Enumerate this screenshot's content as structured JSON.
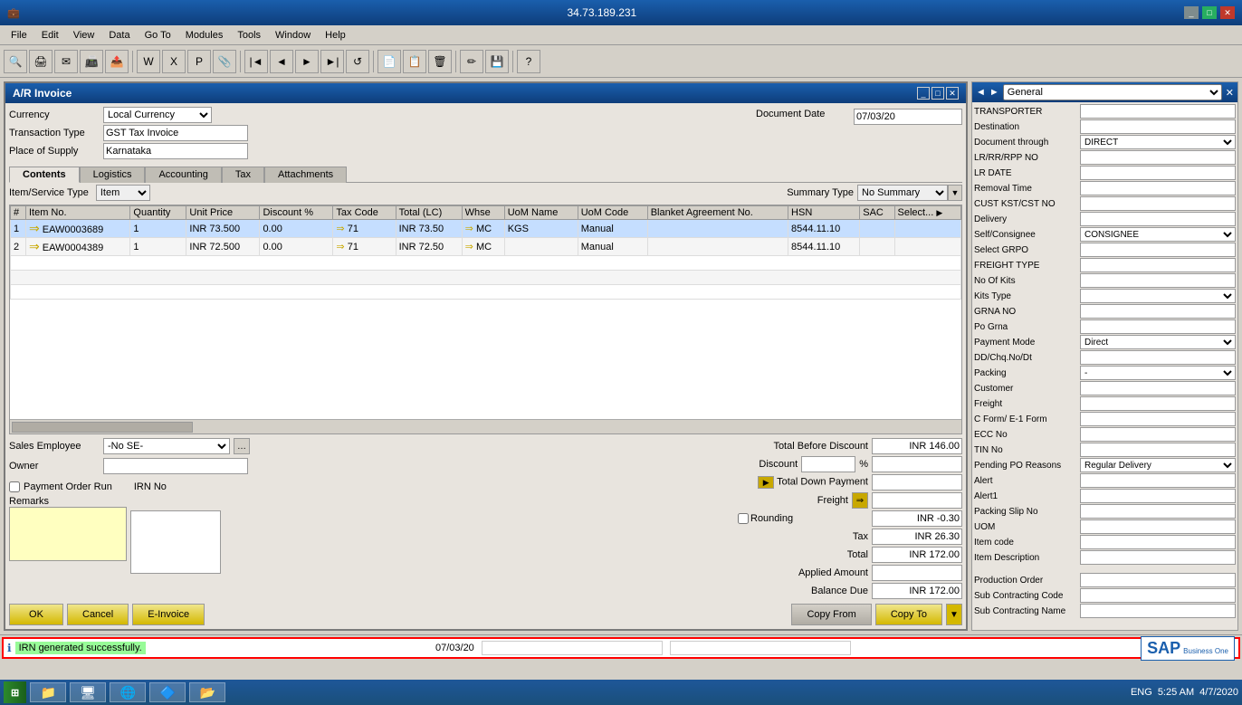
{
  "titlebar": {
    "title": "34.73.189.231",
    "controls": [
      "_",
      "□",
      "✕"
    ]
  },
  "menubar": {
    "items": [
      "File",
      "Edit",
      "View",
      "Data",
      "Go To",
      "Modules",
      "Tools",
      "Window",
      "Help"
    ]
  },
  "invoice": {
    "title": "A/R Invoice",
    "currency_label": "Currency",
    "currency_value": "Local Currency",
    "doc_date_label": "Document Date",
    "doc_date_value": "07/03/20",
    "transaction_type_label": "Transaction Type",
    "transaction_type_value": "GST Tax Invoice",
    "place_of_supply_label": "Place of Supply",
    "place_of_supply_value": "Karnataka",
    "tabs": [
      "Contents",
      "Logistics",
      "Accounting",
      "Tax",
      "Attachments"
    ],
    "active_tab": "Contents",
    "table": {
      "headers": [
        "#",
        "Item No.",
        "Quantity",
        "Unit Price",
        "Discount %",
        "Tax Code",
        "Total (LC)",
        "Whse",
        "UoM Name",
        "UoM Code",
        "Blanket Agreement No.",
        "HSN",
        "SAC",
        "Select..."
      ],
      "rows": [
        {
          "num": "1",
          "item_no": "EAW0003689",
          "quantity": "1",
          "unit_price": "INR 73.500",
          "discount": "0.00",
          "tax_code": "71",
          "total_lc": "INR 73.50",
          "whse": "MC",
          "uom_name": "KGS",
          "uom_code": "Manual",
          "blanket_agr": "",
          "hsn": "8544.11.10",
          "sac": "",
          "select": ""
        },
        {
          "num": "2",
          "item_no": "EAW0004389",
          "quantity": "1",
          "unit_price": "INR 72.500",
          "discount": "0.00",
          "tax_code": "71",
          "total_lc": "INR 72.50",
          "whse": "MC",
          "uom_name": "",
          "uom_code": "Manual",
          "blanket_agr": "",
          "hsn": "8544.11.10",
          "sac": "",
          "select": ""
        }
      ]
    },
    "sales_employee_label": "Sales Employee",
    "sales_employee_value": "-No SE-",
    "owner_label": "Owner",
    "owner_value": "",
    "summary_type_label": "Summary Type",
    "summary_type_value": "No Summary",
    "totals": {
      "before_discount_label": "Total Before Discount",
      "before_discount_value": "INR 146.00",
      "discount_label": "Discount",
      "discount_pct": "%",
      "down_payment_label": "Total Down Payment",
      "freight_label": "Freight",
      "rounding_label": "Rounding",
      "rounding_value": "INR -0.30",
      "tax_label": "Tax",
      "tax_value": "INR 26.30",
      "total_label": "Total",
      "total_value": "INR 172.00",
      "applied_amount_label": "Applied Amount",
      "applied_amount_value": "",
      "balance_due_label": "Balance Due",
      "balance_due_value": "INR 172.00"
    },
    "payment_order_run_label": "Payment Order Run",
    "irn_no_label": "IRN No",
    "remarks_label": "Remarks",
    "buttons": {
      "ok": "OK",
      "cancel": "Cancel",
      "e_invoice": "E-Invoice",
      "copy_from": "Copy From",
      "copy_to": "Copy To"
    }
  },
  "right_panel": {
    "title": "General",
    "fields": [
      {
        "label": "TRANSPORTER",
        "value": "",
        "type": "text"
      },
      {
        "label": "Destination",
        "value": "",
        "type": "text"
      },
      {
        "label": "Document through",
        "value": "DIRECT",
        "type": "select"
      },
      {
        "label": "LR/RR/RPP NO",
        "value": "",
        "type": "text"
      },
      {
        "label": "LR DATE",
        "value": "",
        "type": "text"
      },
      {
        "label": "Removal Time",
        "value": "",
        "type": "text"
      },
      {
        "label": "CUST KST/CST NO",
        "value": "",
        "type": "text"
      },
      {
        "label": "Delivery",
        "value": "",
        "type": "text"
      },
      {
        "label": "Self/Consignee",
        "value": "CONSIGNEE",
        "type": "select"
      },
      {
        "label": "Select GRPO",
        "value": "",
        "type": "text"
      },
      {
        "label": "FREIGHT TYPE",
        "value": "",
        "type": "text"
      },
      {
        "label": "No Of Kits",
        "value": "",
        "type": "text"
      },
      {
        "label": "Kits Type",
        "value": "",
        "type": "select"
      },
      {
        "label": "GRNA NO",
        "value": "",
        "type": "text"
      },
      {
        "label": "Po Grna",
        "value": "",
        "type": "text"
      },
      {
        "label": "Payment Mode",
        "value": "Direct",
        "type": "select"
      },
      {
        "label": "DD/Chq.No/Dt",
        "value": "",
        "type": "text"
      },
      {
        "label": "Packing",
        "value": "-",
        "type": "select"
      },
      {
        "label": "Customer",
        "value": "",
        "type": "text"
      },
      {
        "label": "Freight",
        "value": "",
        "type": "text"
      },
      {
        "label": "C Form/ E-1 Form",
        "value": "",
        "type": "text"
      },
      {
        "label": "ECC No",
        "value": "",
        "type": "text"
      },
      {
        "label": "TIN No",
        "value": "",
        "type": "text"
      },
      {
        "label": "Pending PO Reasons",
        "value": "Regular Delivery",
        "type": "select"
      },
      {
        "label": "Alert",
        "value": "",
        "type": "text"
      },
      {
        "label": "Alert1",
        "value": "",
        "type": "text"
      },
      {
        "label": "Packing Slip No",
        "value": "",
        "type": "text"
      },
      {
        "label": "UOM",
        "value": "",
        "type": "text"
      },
      {
        "label": "Item code",
        "value": "",
        "type": "text"
      },
      {
        "label": "Item Description",
        "value": "",
        "type": "text"
      },
      {
        "label": "Production Order",
        "value": "",
        "type": "text"
      },
      {
        "label": "Sub Contracting Code",
        "value": "",
        "type": "text"
      },
      {
        "label": "Sub Contracting Name",
        "value": "",
        "type": "text"
      }
    ]
  },
  "status_bar": {
    "date": "07/03/20",
    "message": "IRN generated successfully.",
    "icon": "ℹ"
  },
  "taskbar": {
    "time": "5:25 AM",
    "date": "4/7/2020",
    "lang": "ENG",
    "apps": [
      "⊞",
      "📁",
      "🖥",
      "🌐",
      "🖊",
      "🔷"
    ]
  }
}
